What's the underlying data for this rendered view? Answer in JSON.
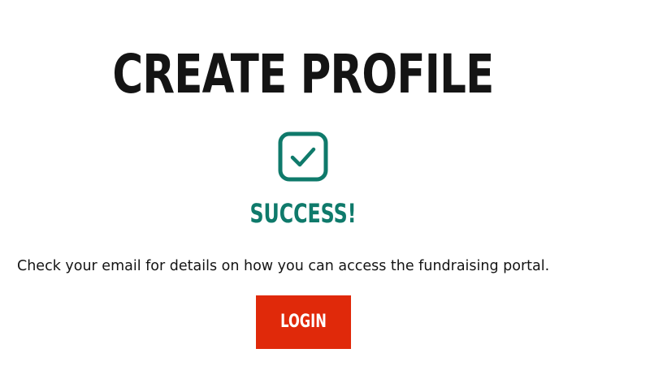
{
  "page": {
    "title": "CREATE PROFILE"
  },
  "status": {
    "icon": "checkbox-check-icon",
    "label": "SUCCESS!",
    "color": "#0f7a6b"
  },
  "message": {
    "text": "Check your email for details on how you can access the fundraising portal."
  },
  "actions": {
    "login_label": "LOGIN",
    "login_color": "#e0290a"
  }
}
